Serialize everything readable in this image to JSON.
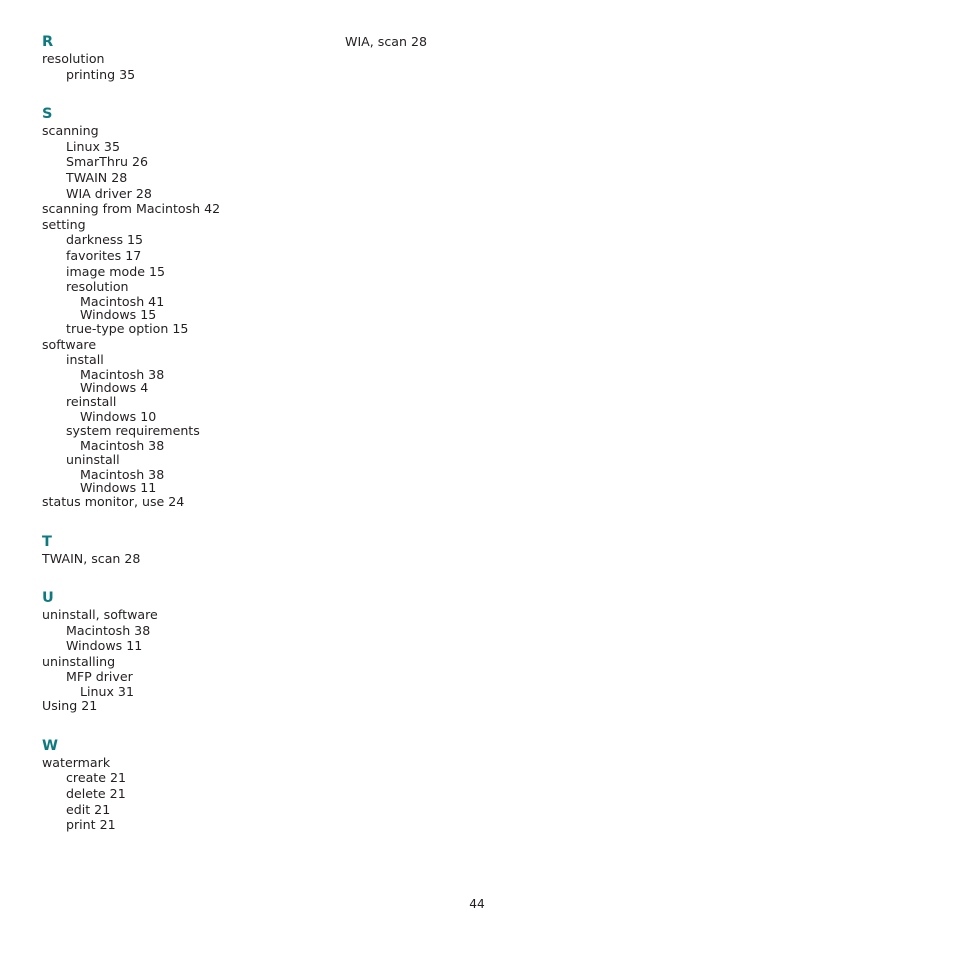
{
  "document": {
    "type": "book-index",
    "page_number": "44",
    "heading_color": "#0e7a80",
    "text_color": "#231f20",
    "background_color": "#ffffff"
  },
  "columns": {
    "left": {
      "groups": [
        {
          "letter": "R",
          "entries": [
            {
              "level": 0,
              "text": "resolution"
            },
            {
              "level": 1,
              "text": "printing 35"
            }
          ]
        },
        {
          "letter": "S",
          "entries": [
            {
              "level": 0,
              "text": "scanning"
            },
            {
              "level": 1,
              "text": "Linux 35"
            },
            {
              "level": 1,
              "text": "SmarThru 26"
            },
            {
              "level": 1,
              "text": "TWAIN 28"
            },
            {
              "level": 1,
              "text": "WIA driver 28"
            },
            {
              "level": 0,
              "text": "scanning from Macintosh 42"
            },
            {
              "level": 0,
              "text": "setting"
            },
            {
              "level": 1,
              "text": "darkness 15"
            },
            {
              "level": 1,
              "text": "favorites 17"
            },
            {
              "level": 1,
              "text": "image mode 15"
            },
            {
              "level": 1,
              "text": "resolution"
            },
            {
              "level": 2,
              "text": "Macintosh 41"
            },
            {
              "level": 2,
              "text": "Windows 15"
            },
            {
              "level": 1,
              "text": "true-type option 15"
            },
            {
              "level": 0,
              "text": "software"
            },
            {
              "level": 1,
              "text": "install"
            },
            {
              "level": 2,
              "text": "Macintosh 38"
            },
            {
              "level": 2,
              "text": "Windows 4"
            },
            {
              "level": 1,
              "text": "reinstall"
            },
            {
              "level": 2,
              "text": "Windows 10"
            },
            {
              "level": 1,
              "text": "system requirements"
            },
            {
              "level": 2,
              "text": "Macintosh 38"
            },
            {
              "level": 1,
              "text": "uninstall"
            },
            {
              "level": 2,
              "text": "Macintosh 38"
            },
            {
              "level": 2,
              "text": "Windows 11"
            },
            {
              "level": 0,
              "text": "status monitor, use 24"
            }
          ]
        },
        {
          "letter": "T",
          "entries": [
            {
              "level": 0,
              "text": "TWAIN, scan 28"
            }
          ]
        },
        {
          "letter": "U",
          "entries": [
            {
              "level": 0,
              "text": "uninstall, software"
            },
            {
              "level": 1,
              "text": "Macintosh 38"
            },
            {
              "level": 1,
              "text": "Windows 11"
            },
            {
              "level": 0,
              "text": "uninstalling"
            },
            {
              "level": 1,
              "text": "MFP driver"
            },
            {
              "level": 2,
              "text": "Linux 31"
            },
            {
              "level": 0,
              "text": "Using 21"
            }
          ]
        },
        {
          "letter": "W",
          "entries": [
            {
              "level": 0,
              "text": "watermark"
            },
            {
              "level": 1,
              "text": "create 21"
            },
            {
              "level": 1,
              "text": "delete 21"
            },
            {
              "level": 1,
              "text": "edit 21"
            },
            {
              "level": 1,
              "text": "print 21"
            }
          ]
        }
      ]
    },
    "right": {
      "groups": [
        {
          "letter": "",
          "entries": [
            {
              "level": 0,
              "text": "WIA, scan 28"
            }
          ]
        }
      ]
    }
  }
}
